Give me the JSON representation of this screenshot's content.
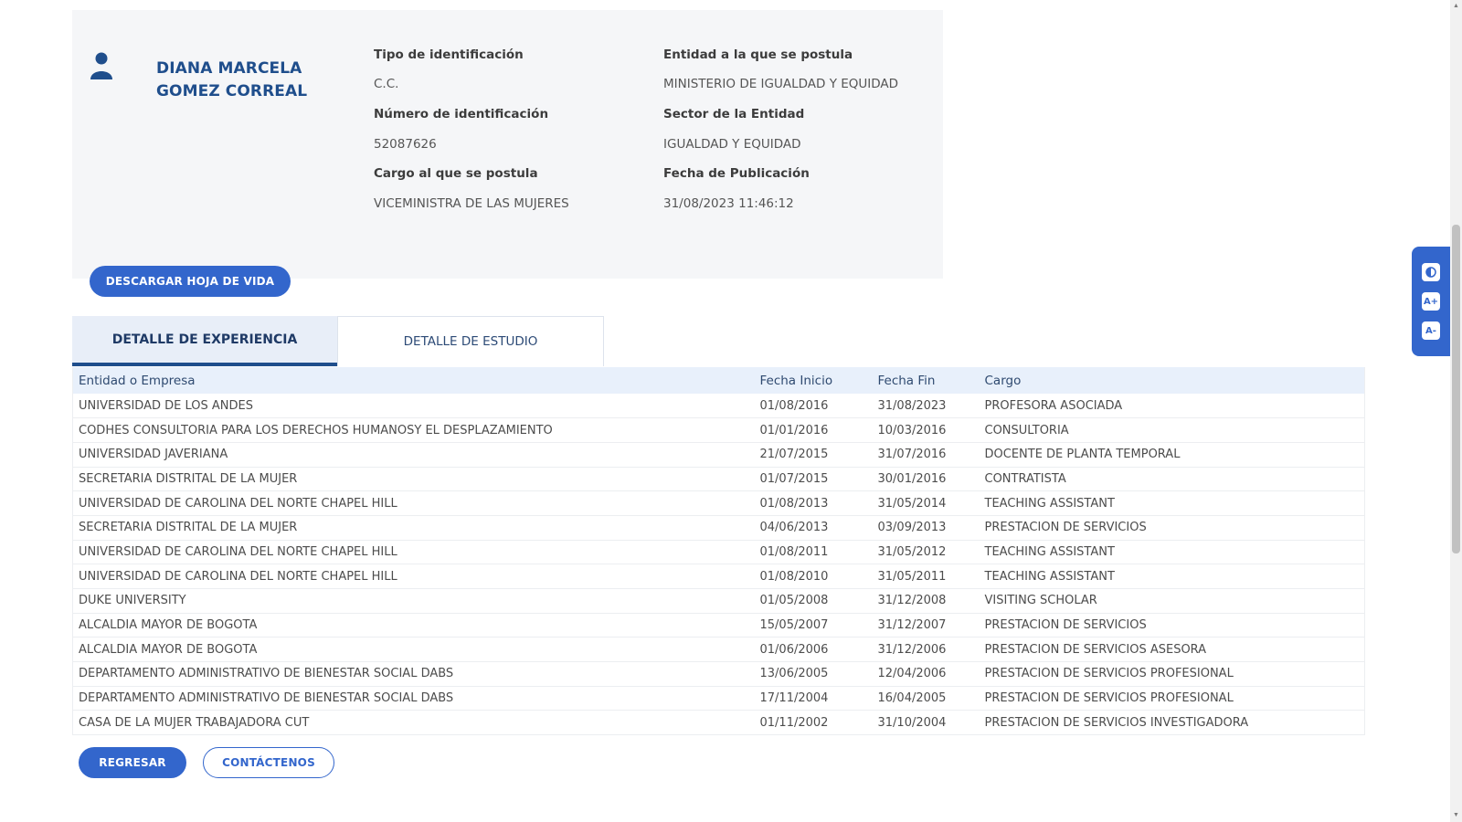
{
  "profile": {
    "name_line1": "DIANA MARCELA",
    "name_line2": "GOMEZ CORREAL",
    "fields": {
      "tipo_label": "Tipo de identificación",
      "tipo_value": "C.C.",
      "numero_label": "Número de identificación",
      "numero_value": "52087626",
      "cargo_label": "Cargo al que se postula",
      "cargo_value": "VICEMINISTRA DE LAS MUJERES",
      "entidad_label": "Entidad a la que se postula",
      "entidad_value": "MINISTERIO DE IGUALDAD Y EQUIDAD",
      "sector_label": "Sector de la Entidad",
      "sector_value": "IGUALDAD Y EQUIDAD",
      "fecha_label": "Fecha de Publicación",
      "fecha_value": "31/08/2023 11:46:12"
    },
    "download_label": "DESCARGAR HOJA DE VIDA"
  },
  "tabs": [
    {
      "label": "DETALLE DE EXPERIENCIA",
      "active": true
    },
    {
      "label": "DETALLE DE ESTUDIO",
      "active": false
    }
  ],
  "table": {
    "headers": [
      "Entidad o Empresa",
      "Fecha Inicio",
      "Fecha Fin",
      "Cargo"
    ],
    "rows": [
      [
        "UNIVERSIDAD DE LOS ANDES",
        "01/08/2016",
        "31/08/2023",
        "PROFESORA ASOCIADA"
      ],
      [
        "CODHES CONSULTORIA PARA LOS DERECHOS HUMANOSY EL DESPLAZAMIENTO",
        "01/01/2016",
        "10/03/2016",
        "CONSULTORIA"
      ],
      [
        "UNIVERSIDAD JAVERIANA",
        "21/07/2015",
        "31/07/2016",
        "DOCENTE DE PLANTA TEMPORAL"
      ],
      [
        "SECRETARIA DISTRITAL DE LA MUJER",
        "01/07/2015",
        "30/01/2016",
        "CONTRATISTA"
      ],
      [
        "UNIVERSIDAD DE CAROLINA DEL NORTE CHAPEL HILL",
        "01/08/2013",
        "31/05/2014",
        "TEACHING ASSISTANT"
      ],
      [
        "SECRETARIA DISTRITAL DE LA MUJER",
        "04/06/2013",
        "03/09/2013",
        "PRESTACION DE SERVICIOS"
      ],
      [
        "UNIVERSIDAD DE CAROLINA DEL NORTE CHAPEL HILL",
        "01/08/2011",
        "31/05/2012",
        "TEACHING ASSISTANT"
      ],
      [
        "UNIVERSIDAD DE CAROLINA DEL NORTE CHAPEL HILL",
        "01/08/2010",
        "31/05/2011",
        "TEACHING ASSISTANT"
      ],
      [
        "DUKE UNIVERSITY",
        "01/05/2008",
        "31/12/2008",
        "VISITING SCHOLAR"
      ],
      [
        "ALCALDIA MAYOR DE BOGOTA",
        "15/05/2007",
        "31/12/2007",
        "PRESTACION DE SERVICIOS"
      ],
      [
        "ALCALDIA MAYOR DE BOGOTA",
        "01/06/2006",
        "31/12/2006",
        "PRESTACION DE SERVICIOS ASESORA"
      ],
      [
        "DEPARTAMENTO ADMINISTRATIVO DE BIENESTAR SOCIAL DABS",
        "13/06/2005",
        "12/04/2006",
        "PRESTACION DE SERVICIOS PROFESIONAL"
      ],
      [
        "DEPARTAMENTO ADMINISTRATIVO DE BIENESTAR SOCIAL DABS",
        "17/11/2004",
        "16/04/2005",
        "PRESTACION DE SERVICIOS PROFESIONAL"
      ],
      [
        "CASA DE LA MUJER TRABAJADORA CUT",
        "01/11/2002",
        "31/10/2004",
        "PRESTACION DE SERVICIOS INVESTIGADORA"
      ]
    ]
  },
  "footer": {
    "back_label": "REGRESAR",
    "contact_label": "CONTÁCTENOS"
  },
  "accessibility": {
    "contrast_icon": "contrast-icon",
    "font_increase_label": "A+",
    "font_decrease_label": "A-"
  },
  "colors": {
    "primary": "#3366cc",
    "heading": "#1f4e8c",
    "card_bg": "#f5f6f8",
    "table_header_bg": "#e8f0fb"
  }
}
